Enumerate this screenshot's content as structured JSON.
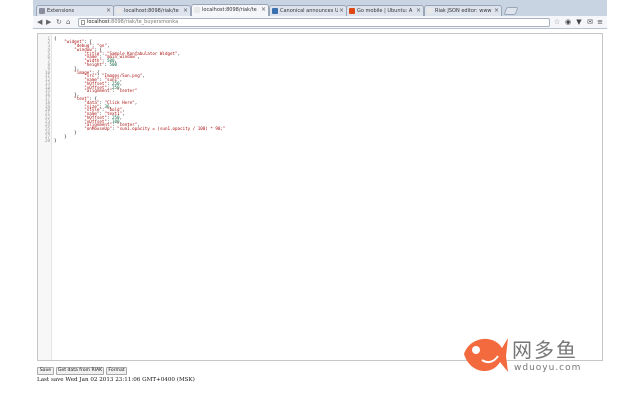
{
  "tabs": [
    {
      "title": "Extensions",
      "active": false,
      "favicon_color": "#8a8fa0"
    },
    {
      "title": "localhost:8098/riak/te",
      "active": false,
      "favicon_color": "#e8e8e8"
    },
    {
      "title": "localhost:8098/riak/te",
      "active": true,
      "favicon_color": "#e8e8e8"
    },
    {
      "title": "Canonical announces U",
      "active": false,
      "favicon_color": "#3a6fb0"
    },
    {
      "title": "Go mobile | Ubuntu: A",
      "active": false,
      "favicon_color": "#dd4814"
    },
    {
      "title": "Riak JSON editor: www",
      "active": false,
      "favicon_color": "#e8e8e8"
    }
  ],
  "toolbar": {
    "back_icon": "back-arrow-icon",
    "forward_icon": "forward-arrow-icon",
    "reload_icon": "reload-icon",
    "home_icon": "home-icon",
    "url_host": "localhost",
    "url_path": ":8098/riak/te_buyersmonka",
    "star_icon": "star-icon",
    "extension_icons": [
      "riak-icon",
      "pocket-icon",
      "mail-icon",
      "menu-icon"
    ]
  },
  "editor": {
    "lines": [
      [
        [
          "p",
          "{"
        ]
      ],
      [
        [
          "p",
          "    "
        ],
        [
          "k",
          "\"widget\""
        ],
        [
          "p",
          ": {"
        ]
      ],
      [
        [
          "p",
          "        "
        ],
        [
          "k",
          "\"debug\""
        ],
        [
          "p",
          ": "
        ],
        [
          "s",
          "\"on\""
        ],
        [
          "p",
          ","
        ]
      ],
      [
        [
          "p",
          "        "
        ],
        [
          "k",
          "\"window\""
        ],
        [
          "p",
          ": {"
        ]
      ],
      [
        [
          "p",
          "            "
        ],
        [
          "k",
          "\"title\""
        ],
        [
          "p",
          ": "
        ],
        [
          "s",
          "\"Sample Konfabulator Widget\""
        ],
        [
          "p",
          ","
        ]
      ],
      [
        [
          "p",
          "            "
        ],
        [
          "k",
          "\"name\""
        ],
        [
          "p",
          ": "
        ],
        [
          "s",
          "\"main_window\""
        ],
        [
          "p",
          ","
        ]
      ],
      [
        [
          "p",
          "            "
        ],
        [
          "k",
          "\"width\""
        ],
        [
          "p",
          ": "
        ],
        [
          "n",
          "500"
        ],
        [
          "p",
          ","
        ]
      ],
      [
        [
          "p",
          "            "
        ],
        [
          "k",
          "\"height\""
        ],
        [
          "p",
          ": "
        ],
        [
          "n",
          "500"
        ]
      ],
      [
        [
          "p",
          "        },"
        ]
      ],
      [
        [
          "p",
          "        "
        ],
        [
          "k",
          "\"image\""
        ],
        [
          "p",
          ": {"
        ]
      ],
      [
        [
          "p",
          "            "
        ],
        [
          "k",
          "\"src\""
        ],
        [
          "p",
          ": "
        ],
        [
          "s",
          "\"Images/Sun.png\""
        ],
        [
          "p",
          ","
        ]
      ],
      [
        [
          "p",
          "            "
        ],
        [
          "k",
          "\"name\""
        ],
        [
          "p",
          ": "
        ],
        [
          "s",
          "\"sun1\""
        ],
        [
          "p",
          ","
        ]
      ],
      [
        [
          "p",
          "            "
        ],
        [
          "k",
          "\"hOffset\""
        ],
        [
          "p",
          ": "
        ],
        [
          "n",
          "250"
        ],
        [
          "p",
          ","
        ]
      ],
      [
        [
          "p",
          "            "
        ],
        [
          "k",
          "\"vOffset\""
        ],
        [
          "p",
          ": "
        ],
        [
          "n",
          "250"
        ],
        [
          "p",
          ","
        ]
      ],
      [
        [
          "p",
          "            "
        ],
        [
          "k",
          "\"alignment\""
        ],
        [
          "p",
          ": "
        ],
        [
          "s",
          "\"center\""
        ]
      ],
      [
        [
          "p",
          "        },"
        ]
      ],
      [
        [
          "p",
          "        "
        ],
        [
          "k",
          "\"text\""
        ],
        [
          "p",
          ": {"
        ]
      ],
      [
        [
          "p",
          "            "
        ],
        [
          "k",
          "\"data\""
        ],
        [
          "p",
          ": "
        ],
        [
          "s",
          "\"Click Here\""
        ],
        [
          "p",
          ","
        ]
      ],
      [
        [
          "p",
          "            "
        ],
        [
          "k",
          "\"size\""
        ],
        [
          "p",
          ": "
        ],
        [
          "n",
          "36"
        ],
        [
          "p",
          ","
        ]
      ],
      [
        [
          "p",
          "            "
        ],
        [
          "k",
          "\"style\""
        ],
        [
          "p",
          ": "
        ],
        [
          "s",
          "\"bold\""
        ],
        [
          "p",
          ","
        ]
      ],
      [
        [
          "p",
          "            "
        ],
        [
          "k",
          "\"name\""
        ],
        [
          "p",
          ": "
        ],
        [
          "s",
          "\"text1\""
        ],
        [
          "p",
          ","
        ]
      ],
      [
        [
          "p",
          "            "
        ],
        [
          "k",
          "\"hOffset\""
        ],
        [
          "p",
          ": "
        ],
        [
          "n",
          "250"
        ],
        [
          "p",
          ","
        ]
      ],
      [
        [
          "p",
          "            "
        ],
        [
          "k",
          "\"vOffset\""
        ],
        [
          "p",
          ": "
        ],
        [
          "n",
          "100"
        ],
        [
          "p",
          ","
        ]
      ],
      [
        [
          "p",
          "            "
        ],
        [
          "k",
          "\"alignment\""
        ],
        [
          "p",
          ": "
        ],
        [
          "s",
          "\"center\""
        ],
        [
          "p",
          ","
        ]
      ],
      [
        [
          "p",
          "            "
        ],
        [
          "k",
          "\"onMouseUp\""
        ],
        [
          "p",
          ": "
        ],
        [
          "s",
          "\"sun1.opacity = (sun1.opacity / 100) * 90;\""
        ]
      ],
      [
        [
          "p",
          "        }"
        ]
      ],
      [
        [
          "p",
          "    }"
        ]
      ],
      [
        [
          "p",
          "}"
        ]
      ]
    ]
  },
  "controls": {
    "save_label": "Save",
    "get_label": "Get data from RIAK",
    "format_label": "Format"
  },
  "status": {
    "text": "Last save Wed Jan 02 2013 23:11:06 GMT+0400 (MSK)"
  },
  "watermark": {
    "brand": "网多鱼",
    "url": "wduoyu.com",
    "fish_color": "#f26a3d"
  }
}
